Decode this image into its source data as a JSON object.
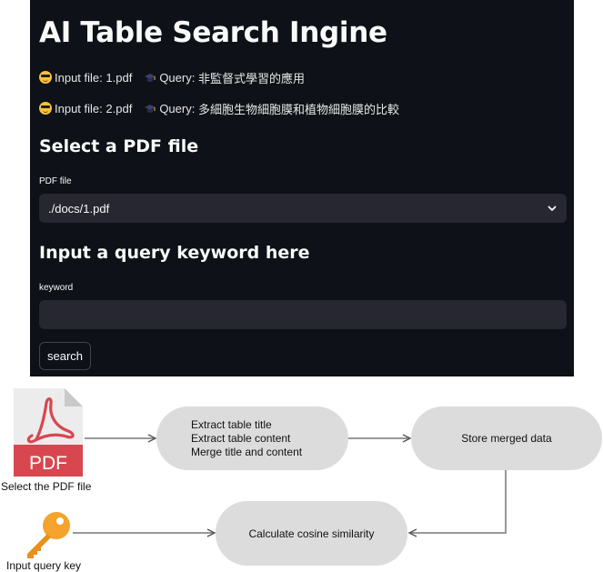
{
  "app": {
    "title": "AI Table Search Ingine",
    "examples": [
      {
        "file_prefix": "Input file:",
        "file": "1.pdf",
        "query_prefix": "Query:",
        "query": "非監督式學習的應用"
      },
      {
        "file_prefix": "Input file:",
        "file": "2.pdf",
        "query_prefix": "Query:",
        "query": "多細胞生物細胞膜和植物細胞膜的比較"
      }
    ],
    "pdf_section_title": "Select a PDF file",
    "pdf_field_label": "PDF file",
    "pdf_selected": "./docs/1.pdf",
    "query_section_title": "Input a query keyword here",
    "keyword_label": "keyword",
    "keyword_value": "",
    "search_label": "search"
  },
  "diagram": {
    "pdf_badge": "PDF",
    "pdf_caption": "Select the PDF file",
    "key_caption": "Input query key",
    "extract_lines": [
      "Extract table title",
      "Extract table content",
      "Merge title and content"
    ],
    "store_label": "Store merged data",
    "cosine_label": "Calculate cosine similarity"
  },
  "colors": {
    "app_bg": "#0e1117",
    "widget_bg": "#262730",
    "pdf_red": "#d8474f",
    "node_bg": "#dcdcdc",
    "key_orange": "#f4a32c"
  }
}
